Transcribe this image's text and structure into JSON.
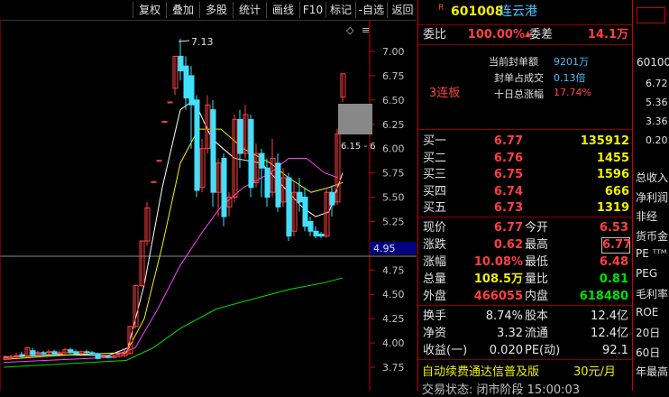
{
  "toolbar": {
    "items": [
      "复权",
      "叠加",
      "多股",
      "统计",
      "画线",
      "F10",
      "标记",
      "-自选",
      "返回"
    ]
  },
  "chart": {
    "high_label": "7.13",
    "range_label": "6.15 - 6",
    "current_price_tag": "4.95",
    "y_ticks": [
      "7.00",
      "6.75",
      "6.50",
      "6.25",
      "6.00",
      "5.75",
      "5.50",
      "5.25",
      "4.75",
      "4.50",
      "4.25",
      "4.00",
      "3.75"
    ],
    "diamond_icon": "◇",
    "menu_icon": "≡"
  },
  "quote": {
    "code_badge": "R",
    "code": "601008",
    "name": "连云港",
    "weibi_label": "委比",
    "weibi_value": "100.00%",
    "weicha_label": "委差",
    "weicha_value": "14.1万",
    "seal_amount_label": "当前封单额",
    "seal_amount_value": "9201万",
    "seal_ratio_label": "封单占成交",
    "seal_ratio_value": "0.13倍",
    "ten_day_label": "十日总涨幅",
    "ten_day_value": "17.74%",
    "streak": "3连板",
    "bids": [
      {
        "label": "买一",
        "price": "6.77",
        "vol": "135912"
      },
      {
        "label": "买二",
        "price": "6.76",
        "vol": "1455"
      },
      {
        "label": "买三",
        "price": "6.75",
        "vol": "1596"
      },
      {
        "label": "买四",
        "price": "6.74",
        "vol": "666"
      },
      {
        "label": "买五",
        "price": "6.73",
        "vol": "1319"
      }
    ],
    "stats": [
      {
        "l1": "现价",
        "v1": "6.77",
        "l2": "今开",
        "v2": "6.53"
      },
      {
        "l1": "涨跌",
        "v1": "0.62",
        "l2": "最高",
        "v2": "6.77"
      },
      {
        "l1": "涨幅",
        "v1": "10.08%",
        "l2": "最低",
        "v2": "6.48"
      },
      {
        "l1": "总量",
        "v1": "108.5万",
        "l2": "量比",
        "v2": "0.81"
      },
      {
        "l1": "外盘",
        "v1": "466055",
        "l2": "内盘",
        "v2": "618480"
      }
    ],
    "fund": [
      {
        "l1": "换手",
        "v1": "8.74%",
        "l2": "股本",
        "v2": "12.4亿"
      },
      {
        "l1": "净资",
        "v1": "3.32",
        "l2": "流通",
        "v2": "12.4亿"
      },
      {
        "l1": "收益(一)",
        "v1": "0.020",
        "l2": "PE(动)",
        "v2": "92.1"
      }
    ],
    "ad_text": "自动续费通达信普及版",
    "ad_price": "30元/月",
    "trade_status": "交易状态: 闭市阶段  15:00:03"
  },
  "side": {
    "code": "60100",
    "prices": [
      "6.72",
      "5.36",
      "3.36",
      "0.20"
    ],
    "labels": [
      "总收入",
      "净利润",
      "非经",
      "货币金",
      "PE ᵀᵀᴹ",
      "PEG",
      "毛利率",
      "ROE",
      "20日",
      "60日",
      "年最高"
    ]
  }
}
